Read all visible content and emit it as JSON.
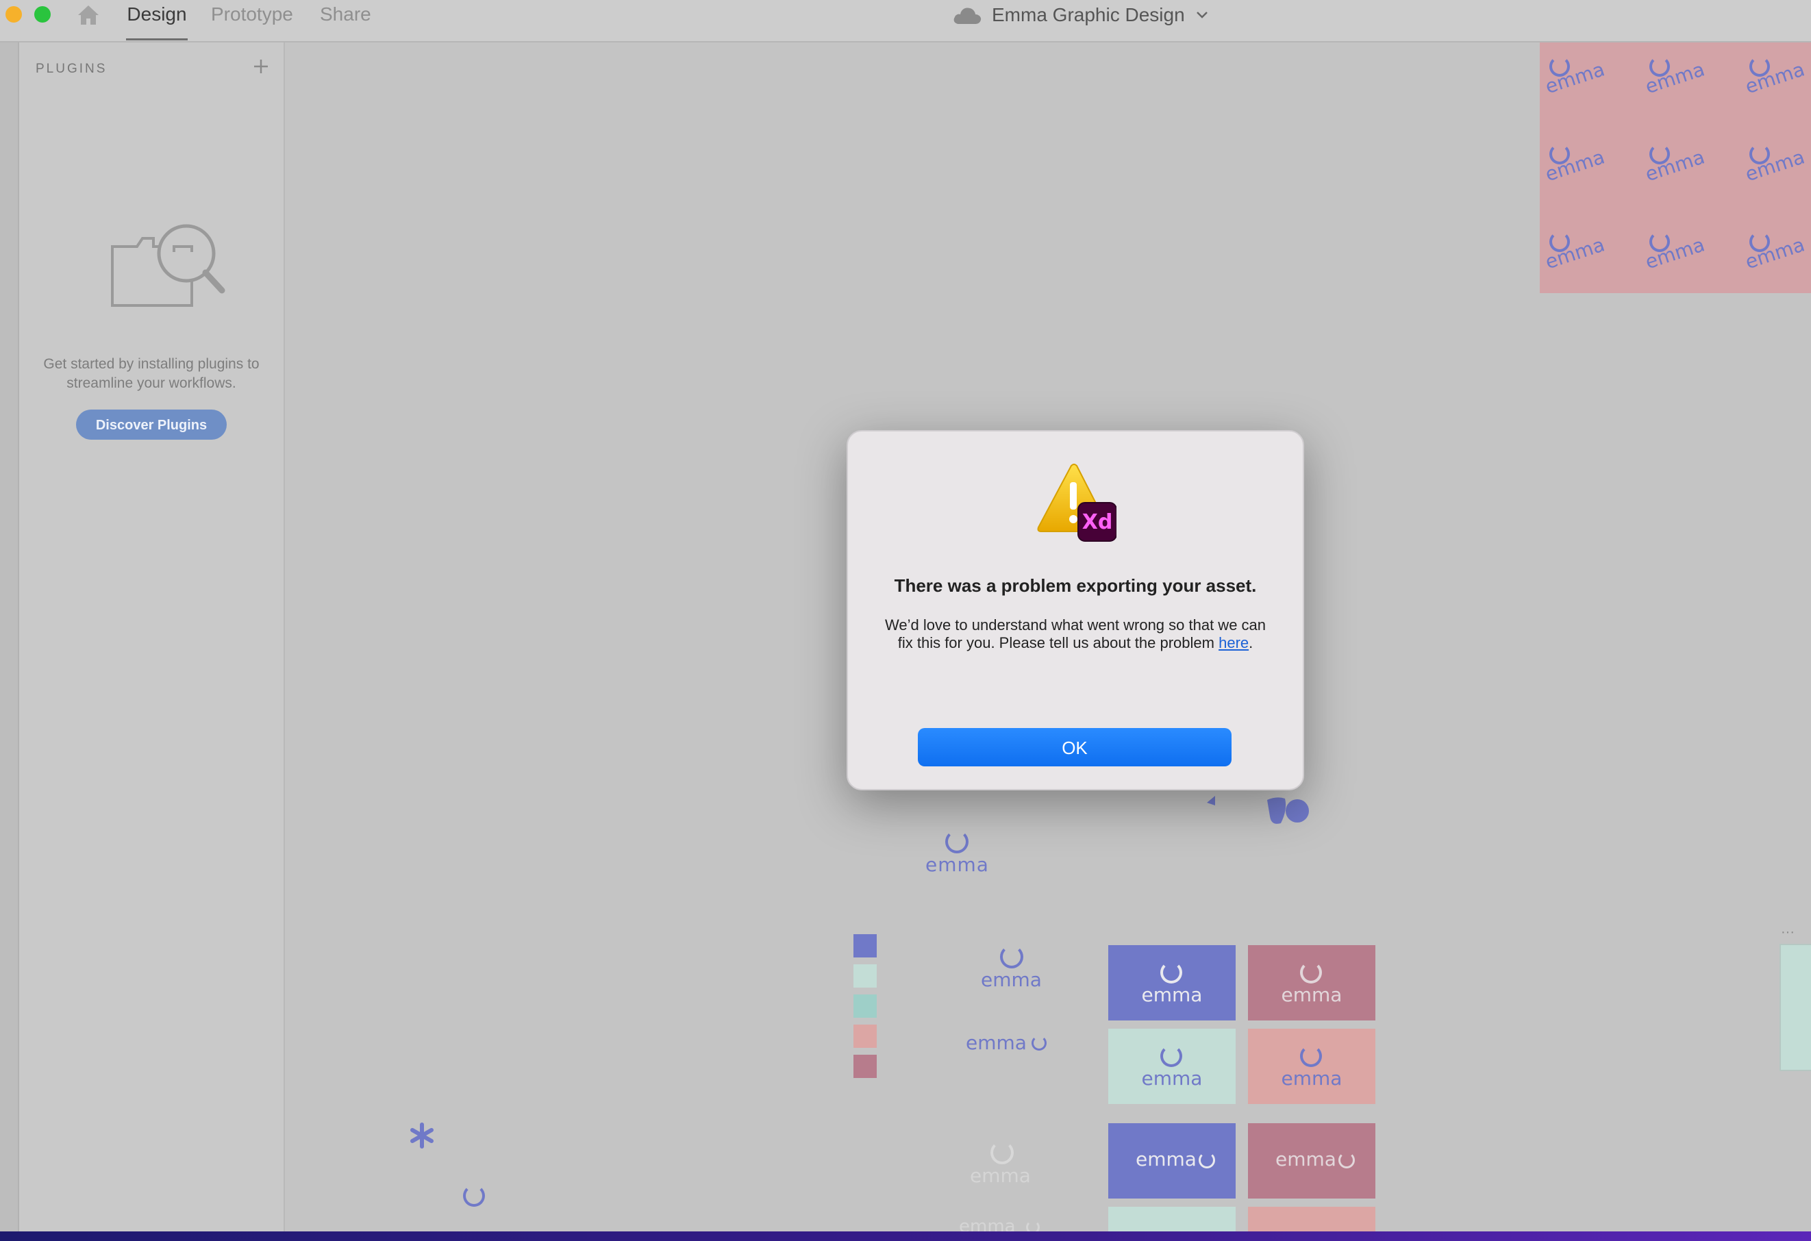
{
  "titlebar": {
    "tabs": [
      {
        "label": "Design",
        "active": true
      },
      {
        "label": "Prototype",
        "active": false
      },
      {
        "label": "Share",
        "active": false
      }
    ],
    "document_title": "Emma Graphic Design",
    "icons": [
      "home-icon",
      "cloud-icon",
      "chevron-down-icon"
    ]
  },
  "plugins": {
    "title": "PLUGINS",
    "add_icon": "plus-icon",
    "empty_text": "Get started by installing plugins to streamline your workflows.",
    "discover_label": "Discover Plugins"
  },
  "canvas": {
    "logo_word": "emma",
    "colors": {
      "periwinkle": "#7079c8",
      "mint": "#c3ddd6",
      "teal": "#9ecfc8",
      "pink": "#dca6a4",
      "mauve": "#b77c8c"
    }
  },
  "modal": {
    "title": "There was a problem exporting your asset.",
    "body_before_link": "We’d love to understand what went wrong so that we can fix this for you. Please tell us about the problem ",
    "link_text": "here",
    "body_after_link": ".",
    "badge": "Xd",
    "ok_label": "OK"
  }
}
